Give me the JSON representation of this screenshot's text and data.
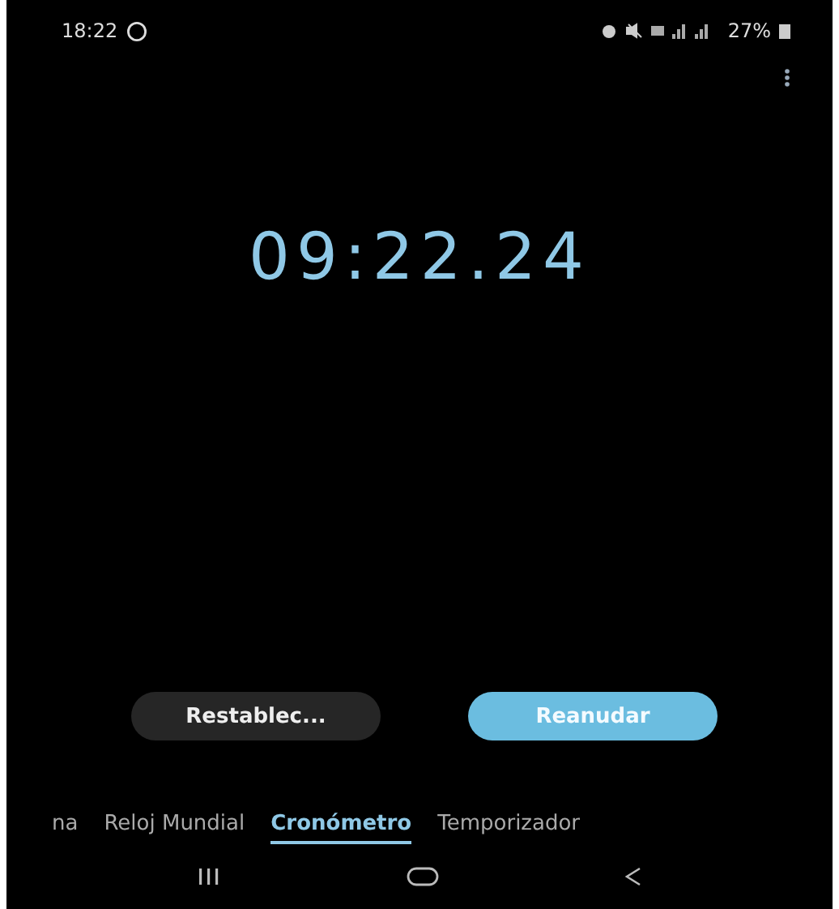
{
  "status_bar": {
    "time": "18:22",
    "battery": "27%"
  },
  "stopwatch": {
    "time": "09:22.24"
  },
  "buttons": [
    {
      "label": "Restablec...",
      "kind": "secondary"
    },
    {
      "label": "Reanudar",
      "kind": "primary"
    }
  ],
  "tabs": [
    {
      "label": "na",
      "selected": false
    },
    {
      "label": "Reloj Mundial",
      "selected": false
    },
    {
      "label": "Cronómetro",
      "selected": true
    },
    {
      "label": "Temporizador",
      "selected": false
    }
  ]
}
